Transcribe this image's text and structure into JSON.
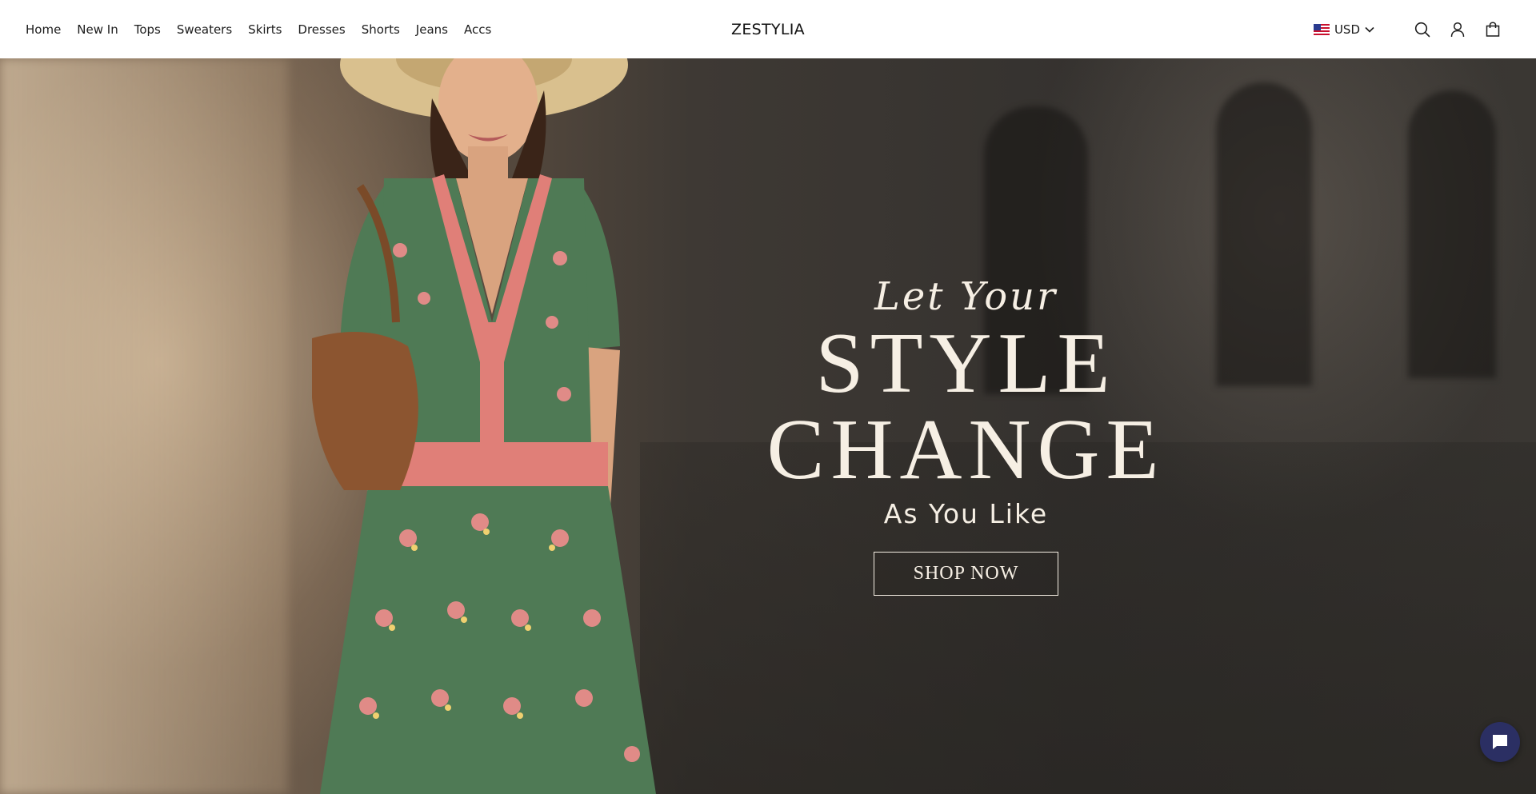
{
  "header": {
    "nav": [
      {
        "label": "Home"
      },
      {
        "label": "New In"
      },
      {
        "label": "Tops"
      },
      {
        "label": "Sweaters"
      },
      {
        "label": "Skirts"
      },
      {
        "label": "Dresses"
      },
      {
        "label": "Shorts"
      },
      {
        "label": "Jeans"
      },
      {
        "label": "Accs"
      }
    ],
    "logo": "ZESTYLIA",
    "currency": {
      "flag_icon": "us-flag-icon",
      "label": "USD",
      "dropdown_icon": "chevron-down-icon"
    },
    "icons": [
      "search-icon",
      "account-icon",
      "cart-icon"
    ]
  },
  "hero": {
    "line1": "Let Your",
    "line2": "STYLE",
    "line3": "CHANGE",
    "line4": "As You Like",
    "cta_label": "SHOP NOW"
  },
  "chat": {
    "icon": "chat-bubble-icon",
    "color": "#2b2f63"
  },
  "colors": {
    "hero_text": "#f6efe4",
    "dress_green": "#4f7a55",
    "dress_trim": "#e07f78"
  }
}
